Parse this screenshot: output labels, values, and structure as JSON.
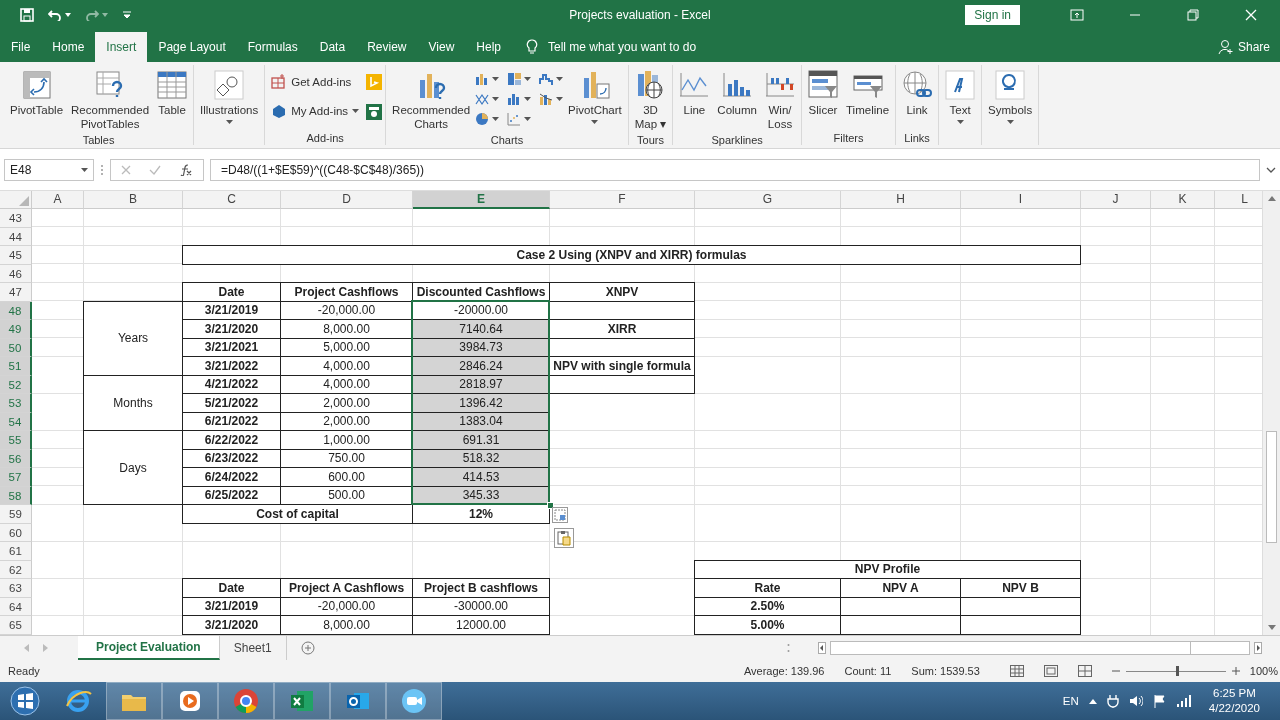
{
  "window": {
    "title": "Projects evaluation  -  Excel",
    "sign_in": "Sign in"
  },
  "menu_tabs": [
    {
      "label": "File",
      "selected": false
    },
    {
      "label": "Home",
      "selected": false
    },
    {
      "label": "Insert",
      "selected": true
    },
    {
      "label": "Page Layout",
      "selected": false
    },
    {
      "label": "Formulas",
      "selected": false
    },
    {
      "label": "Data",
      "selected": false
    },
    {
      "label": "Review",
      "selected": false
    },
    {
      "label": "View",
      "selected": false
    },
    {
      "label": "Help",
      "selected": false
    }
  ],
  "tell_me": {
    "placeholder": "Tell me what you want to do"
  },
  "share": "Share",
  "ribbon_groups": [
    {
      "label": "Tables",
      "buttons": [
        {
          "kind": "large",
          "label": "PivotTable"
        },
        {
          "kind": "large",
          "label": "Recommended\nPivotTables"
        },
        {
          "kind": "large",
          "label": "Table"
        }
      ]
    },
    {
      "buttons": [
        {
          "kind": "large",
          "label": "Illustrations",
          "dropdown": true
        }
      ]
    },
    {
      "label": "Add-ins",
      "buttons": [
        {
          "kind": "small",
          "label": "Get Add-ins"
        },
        {
          "kind": "small",
          "label": "My Add-ins",
          "dropdown": true
        },
        {
          "kind": "tiles"
        }
      ]
    },
    {
      "label": "Charts",
      "buttons": [
        {
          "kind": "large",
          "label": "Recommended\nCharts"
        },
        {
          "kind": "gallery"
        },
        {
          "kind": "large",
          "label": "PivotChart",
          "dropdown": true
        }
      ]
    },
    {
      "label": "Tours",
      "buttons": [
        {
          "kind": "large",
          "label": "3D\nMap ▾"
        }
      ]
    },
    {
      "label": "Sparklines",
      "buttons": [
        {
          "kind": "large",
          "label": "Line"
        },
        {
          "kind": "large",
          "label": "Column"
        },
        {
          "kind": "large",
          "label": "Win/\nLoss"
        }
      ]
    },
    {
      "label": "Filters",
      "buttons": [
        {
          "kind": "large",
          "label": "Slicer"
        },
        {
          "kind": "large",
          "label": "Timeline"
        }
      ]
    },
    {
      "label": "Links",
      "buttons": [
        {
          "kind": "large",
          "label": "Link"
        }
      ]
    },
    {
      "buttons": [
        {
          "kind": "large",
          "label": "Text",
          "dropdown": true
        }
      ]
    },
    {
      "buttons": [
        {
          "kind": "large",
          "label": "Symbols",
          "dropdown": true
        }
      ]
    }
  ],
  "formula_bar": {
    "name_box": "E48",
    "formula": "=D48/((1+$E$59)^((C48-$C$48)/365))"
  },
  "sheet": {
    "columns": [
      {
        "label": "A",
        "selected": false
      },
      {
        "label": "B",
        "selected": false
      },
      {
        "label": "C",
        "selected": false
      },
      {
        "label": "D",
        "selected": false
      },
      {
        "label": "E",
        "selected": true
      },
      {
        "label": "F",
        "selected": false
      },
      {
        "label": "G",
        "selected": false
      },
      {
        "label": "H",
        "selected": false
      },
      {
        "label": "I",
        "selected": false
      },
      {
        "label": "J",
        "selected": false
      },
      {
        "label": "K",
        "selected": false
      },
      {
        "label": "L",
        "selected": false
      }
    ],
    "rows": [
      {
        "label": "43",
        "selected": false
      },
      {
        "label": "44",
        "selected": false
      },
      {
        "label": "45",
        "selected": false
      },
      {
        "label": "46",
        "selected": false
      },
      {
        "label": "47",
        "selected": false
      },
      {
        "label": "48",
        "selected": true
      },
      {
        "label": "49",
        "selected": true
      },
      {
        "label": "50",
        "selected": true
      },
      {
        "label": "51",
        "selected": true
      },
      {
        "label": "52",
        "selected": true
      },
      {
        "label": "53",
        "selected": true
      },
      {
        "label": "54",
        "selected": true
      },
      {
        "label": "55",
        "selected": true
      },
      {
        "label": "56",
        "selected": true
      },
      {
        "label": "57",
        "selected": true
      },
      {
        "label": "58",
        "selected": true
      },
      {
        "label": "59",
        "selected": false
      },
      {
        "label": "60",
        "selected": false
      },
      {
        "label": "61",
        "selected": false
      },
      {
        "label": "62",
        "selected": false
      },
      {
        "label": "63",
        "selected": false
      },
      {
        "label": "64",
        "selected": false
      },
      {
        "label": "65",
        "selected": false
      }
    ],
    "cells": [
      {
        "text": "Case 2 Using (XNPV and XIRR) formulas",
        "bold": true
      },
      {
        "text": "Date",
        "bold": true
      },
      {
        "text": "Project Cashflows",
        "bold": true
      },
      {
        "text": "Discounted Cashflows",
        "bold": true
      },
      {
        "text": "XNPV",
        "bold": true
      },
      {
        "text": "Years",
        "bold": false
      },
      {
        "text": "3/21/2019",
        "bold": true
      },
      {
        "text": "-20,000.00",
        "bold": false
      },
      {
        "text": "-20000.00",
        "bold": false,
        "selected": true,
        "active": true
      },
      {
        "text": "3/21/2020",
        "bold": true
      },
      {
        "text": "8,000.00",
        "bold": false
      },
      {
        "text": "7140.64",
        "bold": false,
        "selected": true,
        "active": false
      },
      {
        "text": "XIRR",
        "bold": true
      },
      {
        "text": "3/21/2021",
        "bold": true
      },
      {
        "text": "5,000.00",
        "bold": false
      },
      {
        "text": "3984.73",
        "bold": false,
        "selected": true,
        "active": false
      },
      {
        "text": "3/21/2022",
        "bold": true
      },
      {
        "text": "4,000.00",
        "bold": false
      },
      {
        "text": "2846.24",
        "bold": false,
        "selected": true,
        "active": false
      },
      {
        "text": "NPV with single formula",
        "bold": true
      },
      {
        "text": "Months",
        "bold": false
      },
      {
        "text": "4/21/2022",
        "bold": true
      },
      {
        "text": "4,000.00",
        "bold": false
      },
      {
        "text": "2818.97",
        "bold": false,
        "selected": true,
        "active": false
      },
      {
        "text": "5/21/2022",
        "bold": true
      },
      {
        "text": "2,000.00",
        "bold": false
      },
      {
        "text": "1396.42",
        "bold": false,
        "selected": true,
        "active": false
      },
      {
        "text": "6/21/2022",
        "bold": true
      },
      {
        "text": "2,000.00",
        "bold": false
      },
      {
        "text": "1383.04",
        "bold": false,
        "selected": true,
        "active": false
      },
      {
        "text": "Days",
        "bold": false
      },
      {
        "text": "6/22/2022",
        "bold": true
      },
      {
        "text": "1,000.00",
        "bold": false
      },
      {
        "text": "691.31",
        "bold": false,
        "selected": true,
        "active": false
      },
      {
        "text": "6/23/2022",
        "bold": true
      },
      {
        "text": "750.00",
        "bold": false
      },
      {
        "text": "518.32",
        "bold": false,
        "selected": true,
        "active": false
      },
      {
        "text": "6/24/2022",
        "bold": true
      },
      {
        "text": "600.00",
        "bold": false
      },
      {
        "text": "414.53",
        "bold": false,
        "selected": true,
        "active": false
      },
      {
        "text": "6/25/2022",
        "bold": true
      },
      {
        "text": "500.00",
        "bold": false
      },
      {
        "text": "345.33",
        "bold": false,
        "selected": true,
        "active": false
      },
      {
        "text": "Cost of capital",
        "bold": true
      },
      {
        "text": "12%",
        "bold": true
      },
      {
        "text": "NPV Profile",
        "bold": true
      },
      {
        "text": "Date",
        "bold": true
      },
      {
        "text": "Project A Cashflows",
        "bold": true
      },
      {
        "text": "Project B cashflows",
        "bold": true
      },
      {
        "text": "Rate",
        "bold": true
      },
      {
        "text": "NPV A",
        "bold": true
      },
      {
        "text": "NPV B",
        "bold": true
      },
      {
        "text": "3/21/2019",
        "bold": true
      },
      {
        "text": "-20,000.00",
        "bold": false
      },
      {
        "text": "-30000.00",
        "bold": false
      },
      {
        "text": "2.50%",
        "bold": true
      },
      {
        "text": "3/21/2020",
        "bold": true
      },
      {
        "text": "8,000.00",
        "bold": false
      },
      {
        "text": "12000.00",
        "bold": false
      },
      {
        "text": "5.00%",
        "bold": true
      }
    ]
  },
  "sheet_tabs": [
    {
      "label": "Project Evaluation",
      "selected": true
    },
    {
      "label": "Sheet1",
      "selected": false
    }
  ],
  "status_bar": {
    "mode": "Ready",
    "average": "Average: 139.96",
    "count": "Count: 11",
    "sum": "Sum: 1539.53",
    "zoom_slider": {
      "level": 0.5
    },
    "zoom": "100%"
  },
  "taskbar": {
    "language": "EN",
    "time": "6:25 PM",
    "date": "4/22/2020"
  }
}
